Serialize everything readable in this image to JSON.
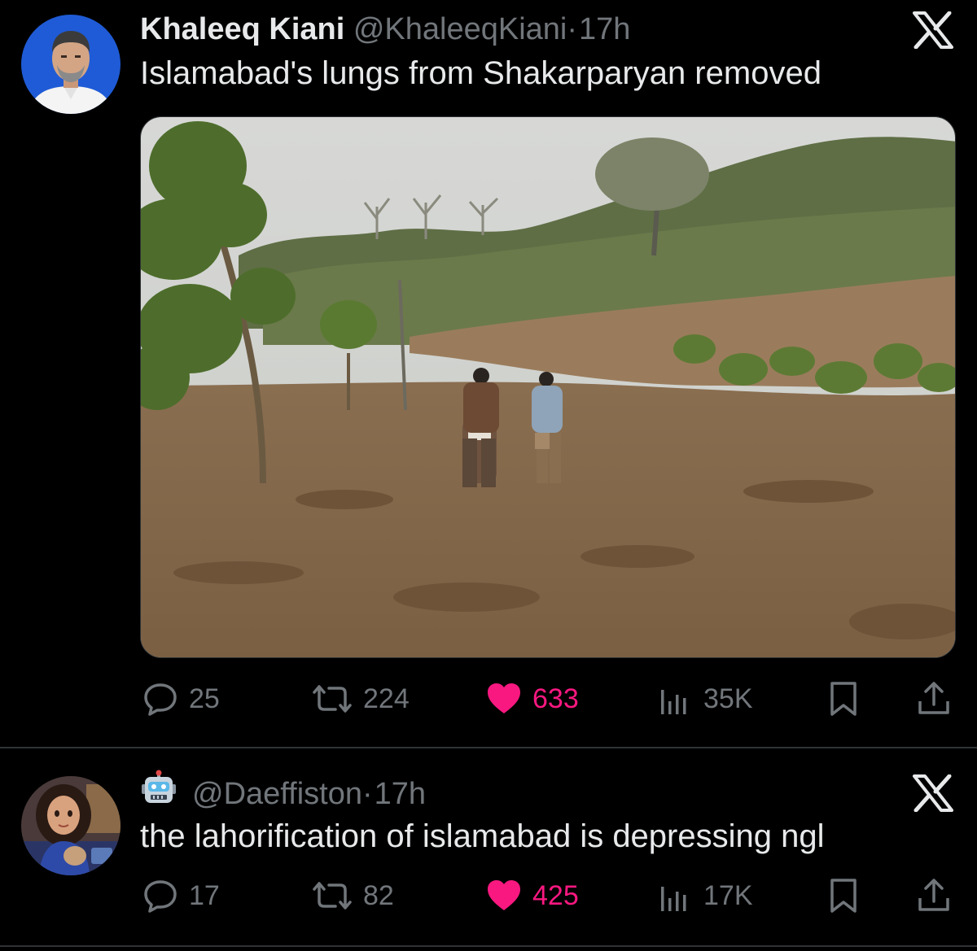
{
  "tweets": [
    {
      "display_name": "Khaleeq Kiani",
      "handle": "@KhaleeqKiani",
      "separator": "·",
      "time": "17h",
      "text": "Islamabad's lungs from Shakarparyan removed",
      "avatar_icon": "man-portrait-avatar",
      "media_icon": "photo-cleared-forest-two-men",
      "stats": {
        "replies": "25",
        "reposts": "224",
        "likes": "633",
        "views": "35K"
      }
    },
    {
      "display_name": "",
      "handle": "@Daeffiston",
      "separator": "·",
      "time": "17h",
      "text": "the lahorification of islamabad is depressing ngl",
      "avatar_icon": "illustrated-girl-avatar",
      "name_emoji_icon": "robot-emoji",
      "stats": {
        "replies": "17",
        "reposts": "82",
        "likes": "425",
        "views": "17K"
      }
    }
  ],
  "colors": {
    "background": "#000000",
    "text_primary": "#e7e9ea",
    "text_secondary": "#71767b",
    "like_pink": "#f91880",
    "divider": "#2f3336"
  }
}
